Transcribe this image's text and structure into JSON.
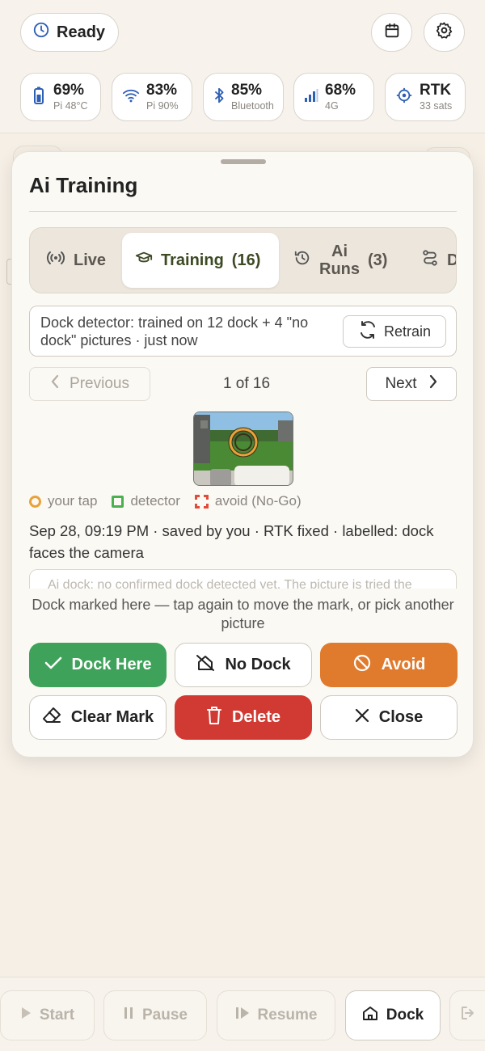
{
  "header": {
    "status_label": "Ready",
    "stats": [
      {
        "icon": "battery-icon",
        "value": "69%",
        "sub": "Pi 48°C"
      },
      {
        "icon": "wifi-icon",
        "value": "83%",
        "sub": "Pi 90%"
      },
      {
        "icon": "bluetooth-icon",
        "value": "85%",
        "sub": "Bluetooth"
      },
      {
        "icon": "signal-bars-icon",
        "value": "68%",
        "sub": "4G"
      },
      {
        "icon": "target-icon",
        "value": "RTK",
        "sub": "33 sats"
      }
    ]
  },
  "sheet": {
    "title": "Ai Training",
    "tabs": {
      "live": "Live",
      "training": "Training",
      "training_count": "(16)",
      "ai_runs_1": "Ai",
      "ai_runs_2": "Runs",
      "ai_runs_count": "(3)",
      "drive": "Driv"
    },
    "retrain": {
      "text": "Dock detector: trained on 12 dock + 4 \"no dock\" pictures · just now",
      "button": "Retrain"
    },
    "pager": {
      "previous": "Previous",
      "position": "1 of 16",
      "next": "Next"
    },
    "legend": {
      "tap": "your tap",
      "detector": "detector",
      "avoid": "avoid (No-Go)"
    },
    "meta": "Sep 28, 09:19 PM · saved by you · RTK fixed · labelled: dock faces the camera",
    "peek_text": "Ai dock: no confirmed dock detected yet. The picture is tried the",
    "hint": "Dock marked here — tap again to move the mark, or pick another picture",
    "actions": {
      "dock_here": "Dock Here",
      "no_dock": "No Dock",
      "avoid": "Avoid",
      "clear_mark": "Clear Mark",
      "delete": "Delete",
      "close": "Close"
    }
  },
  "bottom": {
    "start": "Start",
    "pause": "Pause",
    "resume": "Resume",
    "dock": "Dock"
  },
  "colors": {
    "background": "#f5efe6",
    "green": "#3fa25a",
    "orange": "#e07a2c",
    "red": "#d03a33",
    "tap_marker": "#e8a23a"
  }
}
